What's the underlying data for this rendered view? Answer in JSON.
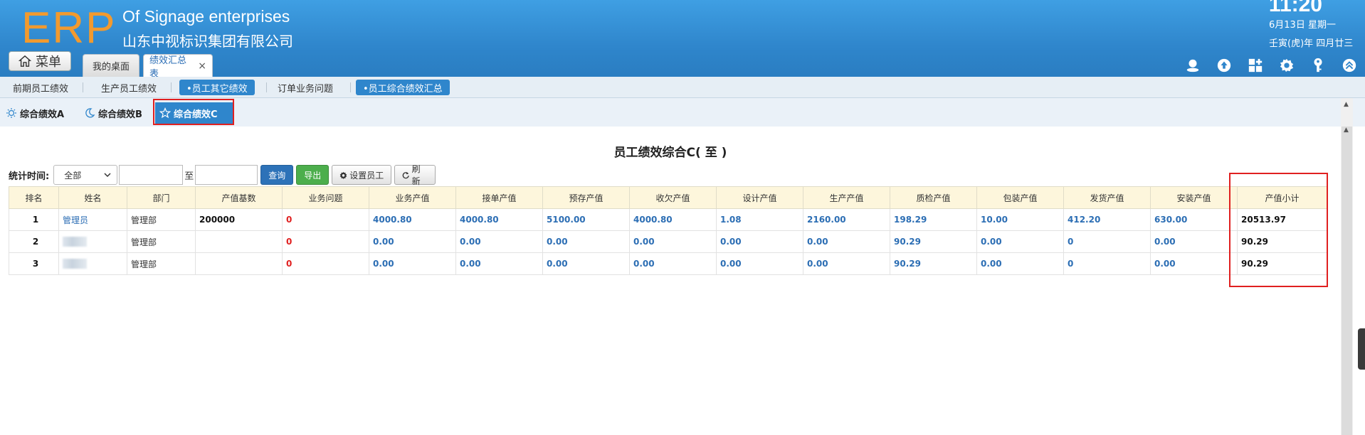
{
  "header": {
    "logo": "ERP",
    "company_en": "Of Signage enterprises",
    "company_cn": "山东中视标识集团有限公司",
    "clock": "11:20",
    "date_line1": "6月13日 星期一",
    "date_line2": "壬寅(虎)年 四月廿三",
    "menu_label": "菜单",
    "tabs": [
      {
        "label": "我的桌面"
      },
      {
        "label": "绩效汇总表",
        "close": "×"
      }
    ],
    "icons": [
      "user-icon",
      "cloud-upload-icon",
      "apps-icon",
      "gear-icon",
      "key-icon",
      "collapse-icon"
    ]
  },
  "subnav": {
    "items": [
      "前期员工绩效",
      "生产员工绩效",
      "•员工其它绩效",
      "订单业务问题",
      "•员工综合绩效汇总"
    ],
    "active": [
      2,
      4
    ]
  },
  "view_tabs": {
    "items": [
      "综合绩效A",
      "综合绩效B",
      "综合绩效C"
    ],
    "active_index": 2
  },
  "main": {
    "title": "员工绩效综合C( 至 )",
    "filter": {
      "label": "统计时间:",
      "select_value": "全部",
      "to_label": "至",
      "start_value": "",
      "end_value": "",
      "query_label": "查询",
      "export_label": "导出",
      "set_staff_label": "设置员工",
      "refresh_label": "刷新"
    },
    "table": {
      "columns": [
        "排名",
        "姓名",
        "部门",
        "产值基数",
        "业务问题",
        "业务产值",
        "接单产值",
        "预存产值",
        "收欠产值",
        "设计产值",
        "生产产值",
        "质检产值",
        "包装产值",
        "发货产值",
        "安装产值",
        "产值小计"
      ],
      "rows": [
        [
          "1",
          "管理员",
          "管理部",
          "200000",
          "0",
          "4000.80",
          "4000.80",
          "5100.00",
          "4000.80",
          "1.08",
          "2160.00",
          "198.29",
          "10.00",
          "412.20",
          "630.00",
          "20513.97"
        ],
        [
          "2",
          "",
          "管理部",
          "",
          "0",
          "0.00",
          "0.00",
          "0.00",
          "0.00",
          "0.00",
          "0.00",
          "90.29",
          "0.00",
          "0",
          "0.00",
          "90.29"
        ],
        [
          "3",
          "",
          "管理部",
          "",
          "0",
          "0.00",
          "0.00",
          "0.00",
          "0.00",
          "0.00",
          "0.00",
          "90.29",
          "0.00",
          "0",
          "0.00",
          "90.29"
        ]
      ]
    }
  },
  "colors": {
    "header_blue": "#2f86cc",
    "logo_orange": "#f29a2e",
    "value_blue": "#2c6eb4",
    "alert_red": "#e02020",
    "table_head": "#fdf6dc"
  }
}
